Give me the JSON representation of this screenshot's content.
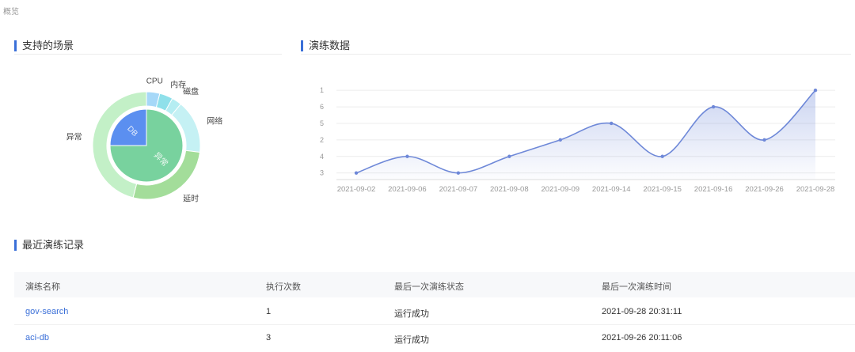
{
  "breadcrumb": "概览",
  "scenes": {
    "title": "支持的场景",
    "inner": [
      {
        "name": "异常",
        "value": 75,
        "color": "#78d29e"
      },
      {
        "name": "DB",
        "value": 25,
        "color": "#5b8ff0"
      }
    ],
    "outer": [
      {
        "name": "CPU",
        "value": 4,
        "color": "#a6d8f8"
      },
      {
        "name": "内存",
        "value": 4,
        "color": "#8fe0ea"
      },
      {
        "name": "磁盘",
        "value": 3,
        "color": "#b5edf2"
      },
      {
        "name": "网络",
        "value": 16,
        "color": "#c5f1f4"
      },
      {
        "name": "延时",
        "value": 27,
        "color": "#a3dd9a"
      },
      {
        "name": "异常",
        "value": 46,
        "color": "#c3f0c7"
      }
    ]
  },
  "drill": {
    "title": "演练数据",
    "chart_data": {
      "type": "area",
      "x": [
        "2021-09-02",
        "2021-09-06",
        "2021-09-07",
        "2021-09-08",
        "2021-09-09",
        "2021-09-14",
        "2021-09-15",
        "2021-09-16",
        "2021-09-26",
        "2021-09-28"
      ],
      "values": [
        3,
        4,
        3,
        4,
        5,
        6,
        4,
        7,
        5,
        8
      ],
      "yticks": [
        "3",
        "4",
        "2",
        "5",
        "6",
        "1"
      ],
      "ylim": [
        2.6,
        8.2
      ],
      "grid": true,
      "color": "#6e88d8"
    }
  },
  "records": {
    "title": "最近演练记录",
    "columns": [
      "演练名称",
      "执行次数",
      "最后一次演练状态",
      "最后一次演练时间"
    ],
    "rows": [
      {
        "name": "gov-search",
        "count": "1",
        "status": "运行成功",
        "time": "2021-09-28 20:31:11"
      },
      {
        "name": "aci-db",
        "count": "3",
        "status": "运行成功",
        "time": "2021-09-26 20:11:06"
      }
    ]
  }
}
